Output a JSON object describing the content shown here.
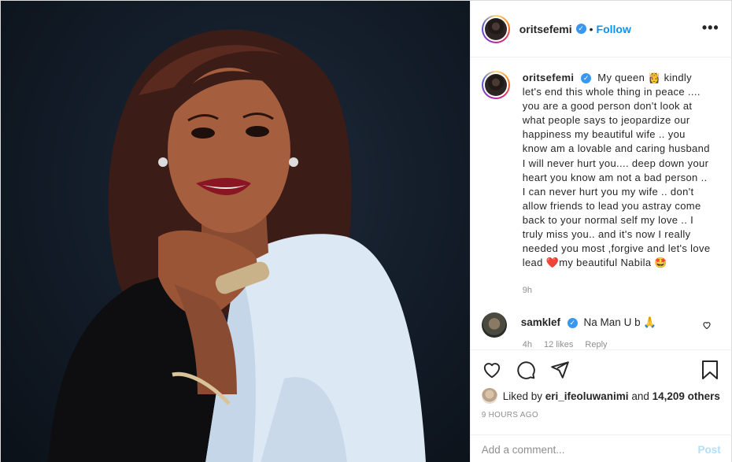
{
  "post": {
    "username": "oritsefemi",
    "follow_label": "Follow",
    "dot": "•",
    "more_label": "•••",
    "verified_glyph": "✓"
  },
  "caption": {
    "username": "oritsefemi",
    "text": "My queen 👸 kindly let's end this whole thing in peace .... you are a good person don't look at what people says to jeopardize our happiness my beautiful wife .. you know am a lovable and caring husband I will never hurt you.... deep down your heart you know am not a bad person .. I can never hurt you my wife .. don't allow friends to lead you astray come back to your normal self my love .. I truly miss you.. and it's now I really needed you most ,forgive and let's love lead ❤️my beautiful Nabila 🤩",
    "time": "9h"
  },
  "comment": {
    "username": "samklef",
    "text": "Na Man U b 🙏",
    "time": "4h",
    "likes": "12 likes",
    "reply": "Reply"
  },
  "actions": {
    "icons": [
      "heart-icon",
      "comment-icon",
      "share-icon",
      "bookmark-icon"
    ]
  },
  "likes": {
    "prefix": "Liked by",
    "user": "eri_ifeoluwanimi",
    "and": "and",
    "others": "14,209 others"
  },
  "timestamp": "9 HOURS AGO",
  "add_comment": {
    "placeholder": "Add a comment...",
    "post_label": "Post"
  },
  "colors": {
    "accent": "#0095f6",
    "verified": "#3897f0",
    "muted": "#8e8e8e",
    "photo_bg": "#121b27"
  }
}
